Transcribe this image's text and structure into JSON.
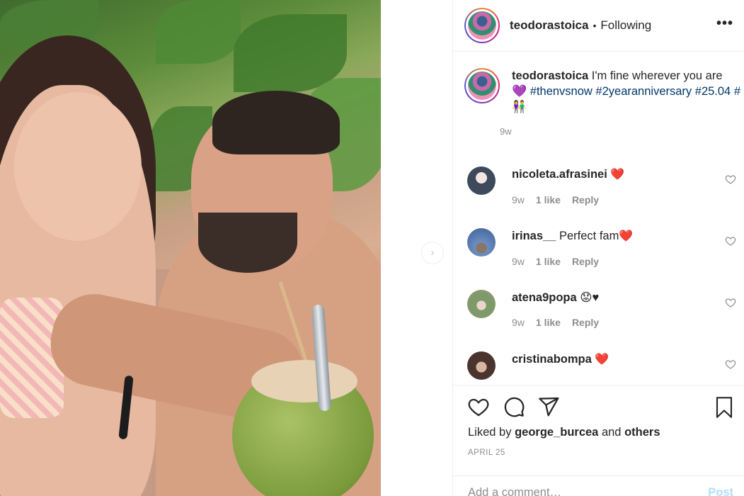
{
  "post": {
    "username": "teodorastoica",
    "follow_status": "Following",
    "more_label": "•••",
    "caption_prefix": "I'm fine wherever you are",
    "caption_heart": "💜",
    "hashtags": [
      "#thenvsnow",
      "#2yearanniversary",
      "#25.04",
      "#"
    ],
    "caption_emoji": "👫",
    "caption_time": "9w"
  },
  "comments": [
    {
      "username": "nicoleta.afrasinei",
      "text": "",
      "emoji": "❤️",
      "time": "9w",
      "likes": "1 like",
      "reply": "Reply",
      "avatar_color": "#3d4a5c"
    },
    {
      "username": "irinas__",
      "text": "Perfect fam",
      "emoji": "❤️",
      "time": "9w",
      "likes": "1 like",
      "reply": "Reply",
      "avatar_color": "#5d7fb0"
    },
    {
      "username": "atena9popa",
      "text": "",
      "emoji": "😟♥",
      "time": "9w",
      "likes": "1 like",
      "reply": "Reply",
      "avatar_color": "#8a7c6a"
    },
    {
      "username": "cristinabompa",
      "text": "",
      "emoji": "❤️",
      "time": "",
      "likes": "",
      "reply": "",
      "avatar_color": "#5a4038"
    }
  ],
  "actions": {
    "liked_by_prefix": "Liked by",
    "liked_by_user": "george_burcea",
    "liked_by_and": "and",
    "liked_by_others": "others",
    "date": "APRIL 25",
    "add_comment_placeholder": "Add a comment…",
    "post_label": "Post"
  },
  "nav": {
    "next_symbol": "›"
  }
}
